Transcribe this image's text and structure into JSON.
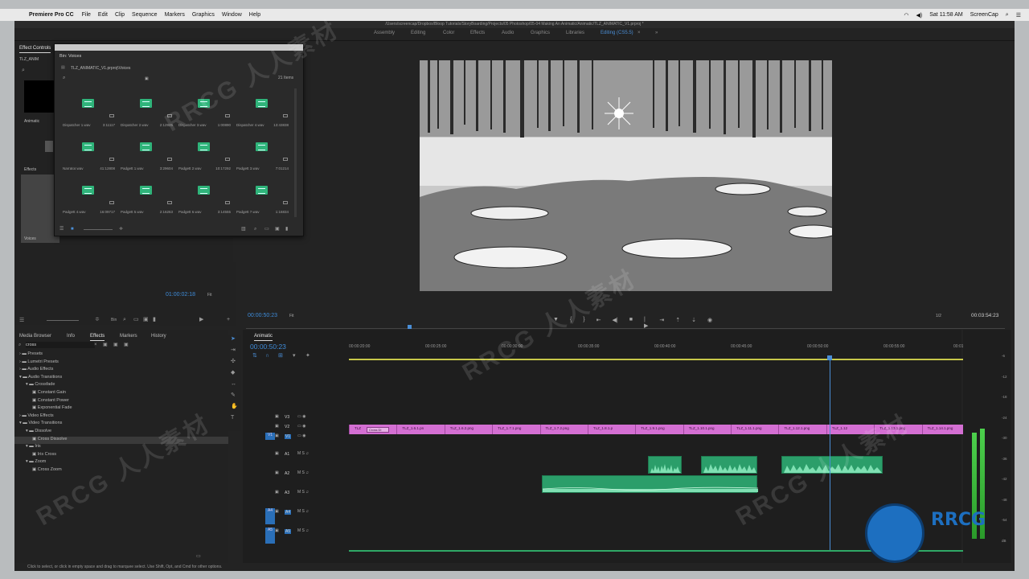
{
  "menubar": {
    "app": "Premiere Pro CC",
    "items": [
      "File",
      "Edit",
      "Clip",
      "Sequence",
      "Markers",
      "Graphics",
      "Window",
      "Help"
    ],
    "clock": "Sat 11:58 AM",
    "user": "ScreenCap"
  },
  "window": {
    "path": "/Users/screencap/Dropbox/Bloop Tutorials/StoryBoarding/Projects/05 Photoshop/05-04 Making An Animatic/Animatic/TLZ_ANIMATIC_V1.prproj *"
  },
  "workspaces": [
    "Assembly",
    "Editing",
    "Color",
    "Effects",
    "Audio",
    "Graphics",
    "Libraries",
    "Editing (CS5.5)"
  ],
  "left_top": {
    "tab": "Effect Controls",
    "seq_label": "TLZ_ANIM",
    "animatic_label": "Animatic",
    "effects_label": "Effects",
    "voices_label": "Voices"
  },
  "bin": {
    "title": "Bin: Voices",
    "path": "TLZ_ANIMATIC_V1.prproj\\Voices",
    "count": "21 Items",
    "items": [
      {
        "name": "Dispatcher 1.wav",
        "dur": "3:11117"
      },
      {
        "name": "Dispatcher 2.wav",
        "dur": "2:12925"
      },
      {
        "name": "Dispatcher 3.wav",
        "dur": "1:00890"
      },
      {
        "name": "Dispatcher 4.wav",
        "dur": "13:43838"
      },
      {
        "name": "Narrator.wav",
        "dur": "41:12808"
      },
      {
        "name": "Padgett 1.wav",
        "dur": "3:29604"
      },
      {
        "name": "Padgett 2.wav",
        "dur": "10:17292"
      },
      {
        "name": "Padgett 3.wav",
        "dur": "7:01214"
      },
      {
        "name": "Padgett 4.wav",
        "dur": "16:09717"
      },
      {
        "name": "Padgett 5.wav",
        "dur": "2:16263"
      },
      {
        "name": "Padgett 6.wav",
        "dur": "3:14555"
      },
      {
        "name": "Padgett 7.wav",
        "dur": "1:16834"
      }
    ]
  },
  "source": {
    "timecode": "01:00:02:18",
    "fit": "Fit"
  },
  "program": {
    "timecode": "00:00:50:23",
    "fit": "Fit",
    "ratio": "1/2",
    "duration": "00:03:54:23"
  },
  "effects_panel": {
    "tabs": [
      "Media Browser",
      "Info",
      "Effects",
      "Markers",
      "History"
    ],
    "search": "cross",
    "tree": [
      {
        "label": "Presets",
        "level": 0,
        "type": "folder"
      },
      {
        "label": "Lumetri Presets",
        "level": 0,
        "type": "folder"
      },
      {
        "label": "Audio Effects",
        "level": 0,
        "type": "folder"
      },
      {
        "label": "Audio Transitions",
        "level": 0,
        "type": "folder",
        "open": true
      },
      {
        "label": "Crossfade",
        "level": 1,
        "type": "folder",
        "open": true
      },
      {
        "label": "Constant Gain",
        "level": 2,
        "type": "item"
      },
      {
        "label": "Constant Power",
        "level": 2,
        "type": "item"
      },
      {
        "label": "Exponential Fade",
        "level": 2,
        "type": "item"
      },
      {
        "label": "Video Effects",
        "level": 0,
        "type": "folder"
      },
      {
        "label": "Video Transitions",
        "level": 0,
        "type": "folder",
        "open": true
      },
      {
        "label": "Dissolve",
        "level": 1,
        "type": "folder",
        "open": true
      },
      {
        "label": "Cross Dissolve",
        "level": 2,
        "type": "item",
        "selected": true
      },
      {
        "label": "Iris",
        "level": 1,
        "type": "folder",
        "open": true
      },
      {
        "label": "Iris Cross",
        "level": 2,
        "type": "item"
      },
      {
        "label": "Zoom",
        "level": 1,
        "type": "folder",
        "open": true
      },
      {
        "label": "Cross Zoom",
        "level": 2,
        "type": "item"
      }
    ]
  },
  "timeline": {
    "tab": "Animatic",
    "timecode": "00:00:50:23",
    "ruler": [
      "00:00:20:00",
      "00:00:25:00",
      "00:00:30:00",
      "00:00:35:00",
      "00:00:40:00",
      "00:00:45:00",
      "00:00:50:00",
      "00:00:55:00",
      "00:01"
    ],
    "tracks": [
      {
        "id": "V3",
        "kind": "video"
      },
      {
        "id": "V2",
        "kind": "video"
      },
      {
        "id": "V1",
        "kind": "video",
        "src": "V1"
      },
      {
        "id": "A1",
        "kind": "audio"
      },
      {
        "id": "A2",
        "kind": "audio"
      },
      {
        "id": "A3",
        "kind": "audio"
      },
      {
        "id": "A4",
        "kind": "audio",
        "src": "A4"
      },
      {
        "id": "A5",
        "kind": "audio",
        "src": "A5"
      }
    ],
    "video_clips": [
      "TLZ",
      "TLZ_1.6.1.pn",
      "TLZ_1.6.2.png",
      "TLZ_1.7.1.png",
      "TLZ_1.7.2.png",
      "TLZ_1.8.1.p",
      "TLZ_1.9.1.png",
      "TLZ_1.10.1.png",
      "TLZ_1.11.1.png",
      "TLZ_1.12.1.png",
      "TLZ_1.12",
      "TLZ_1.13.1.png",
      "TLZ_1.14.1.png"
    ],
    "transition_label": "Cross Di",
    "meter_scale": [
      "-6",
      "-12",
      "-18",
      "-24",
      "-30",
      "-36",
      "-42",
      "-48",
      "-54",
      "dB"
    ],
    "meter_levels": [
      0.55,
      0.57
    ],
    "colors": {
      "video_clip": "#d46fd3",
      "audio_clip": "#2b9e6a",
      "playhead": "#4a8ed6",
      "accent": "#3e8bd8"
    }
  },
  "status": "Click to select, or click in empty space and drag to marquee select. Use Shift, Opt, and Cmd for other options.",
  "watermark": "RRCG 人人素材"
}
